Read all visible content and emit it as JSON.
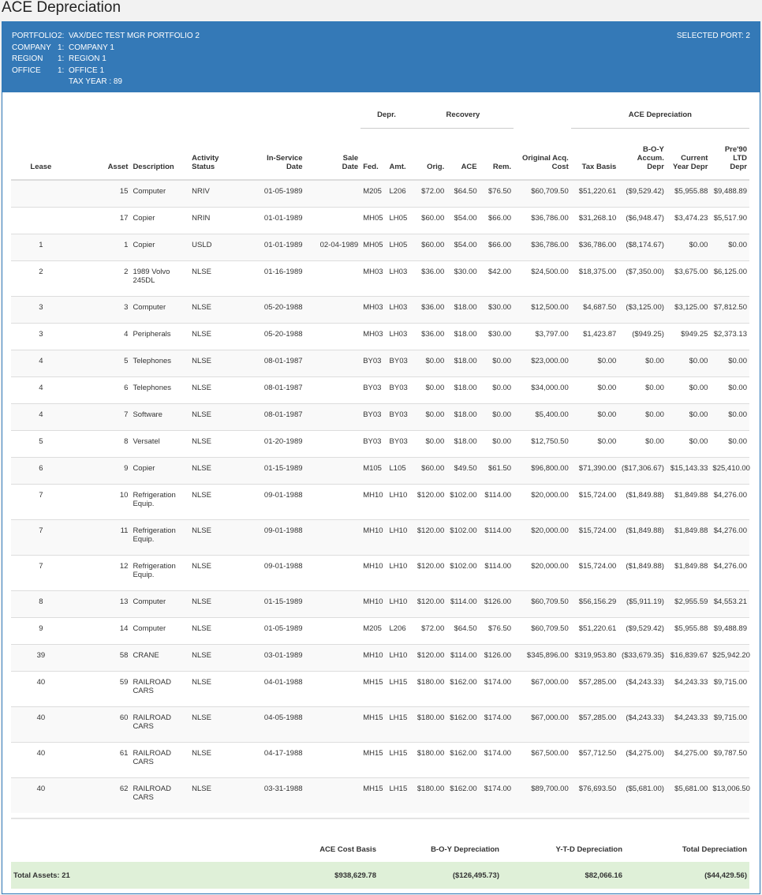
{
  "page": {
    "title": "ACE Depreciation"
  },
  "header": {
    "rows": [
      {
        "key": "PORTFOLIO",
        "num": "2:",
        "value": "VAX/DEC TEST MGR PORTFOLIO 2"
      },
      {
        "key": "COMPANY",
        "num": "1:",
        "value": "COMPANY 1"
      },
      {
        "key": "REGION",
        "num": "1:",
        "value": "REGION 1"
      },
      {
        "key": "OFFICE",
        "num": "1:",
        "value": "OFFICE 1"
      },
      {
        "key": "",
        "num": "",
        "value": "TAX YEAR : 89"
      }
    ],
    "selected_port": "SELECTED PORT: 2"
  },
  "groups": {
    "depr": "Depr.",
    "recovery": "Recovery",
    "ace_depr": "ACE Depreciation"
  },
  "columns": {
    "lease": "Lease",
    "asset": "Asset",
    "description": "Description",
    "activity_status_1": "Activity",
    "activity_status_2": "Status",
    "in_service_1": "In-Service",
    "in_service_2": "Date",
    "sale_1": "Sale",
    "sale_2": "Date",
    "fed": "Fed.",
    "amt": "Amt.",
    "orig": "Orig.",
    "ace": "ACE",
    "rem": "Rem.",
    "orig_cost_1": "Original Acq.",
    "orig_cost_2": "Cost",
    "tax_basis": "Tax Basis",
    "boy_1": "B-O-Y",
    "boy_2": "Accum.",
    "boy_3": "Depr",
    "cur_1": "Current",
    "cur_2": "Year Depr",
    "pre90_1": "Pre'90",
    "pre90_2": "LTD",
    "pre90_3": "Depr"
  },
  "rows": [
    {
      "lease": "",
      "asset": "15",
      "desc": "Computer",
      "status": "NRIV",
      "in_service": "01-05-1989",
      "sale": "",
      "fed": "M205",
      "amt": "L206",
      "orig": "$72.00",
      "ace": "$64.50",
      "rem": "$76.50",
      "cost": "$60,709.50",
      "tax_basis": "$51,220.61",
      "boy": "($9,529.42)",
      "cur": "$5,955.88",
      "pre90": "$9,488.89"
    },
    {
      "lease": "",
      "asset": "17",
      "desc": "Copier",
      "status": "NRIN",
      "in_service": "01-01-1989",
      "sale": "",
      "fed": "MH05",
      "amt": "LH05",
      "orig": "$60.00",
      "ace": "$54.00",
      "rem": "$66.00",
      "cost": "$36,786.00",
      "tax_basis": "$31,268.10",
      "boy": "($6,948.47)",
      "cur": "$3,474.23",
      "pre90": "$5,517.90"
    },
    {
      "lease": "1",
      "asset": "1",
      "desc": "Copier",
      "status": "USLD",
      "in_service": "01-01-1989",
      "sale": "02-04-1989",
      "fed": "MH05",
      "amt": "LH05",
      "orig": "$60.00",
      "ace": "$54.00",
      "rem": "$66.00",
      "cost": "$36,786.00",
      "tax_basis": "$36,786.00",
      "boy": "($8,174.67)",
      "cur": "$0.00",
      "pre90": "$0.00"
    },
    {
      "lease": "2",
      "asset": "2",
      "desc": "1989 Volvo 245DL",
      "status": "NLSE",
      "in_service": "01-16-1989",
      "sale": "",
      "fed": "MH03",
      "amt": "LH03",
      "orig": "$36.00",
      "ace": "$30.00",
      "rem": "$42.00",
      "cost": "$24,500.00",
      "tax_basis": "$18,375.00",
      "boy": "($7,350.00)",
      "cur": "$3,675.00",
      "pre90": "$6,125.00",
      "tall": true
    },
    {
      "lease": "3",
      "asset": "3",
      "desc": "Computer",
      "status": "NLSE",
      "in_service": "05-20-1988",
      "sale": "",
      "fed": "MH03",
      "amt": "LH03",
      "orig": "$36.00",
      "ace": "$18.00",
      "rem": "$30.00",
      "cost": "$12,500.00",
      "tax_basis": "$4,687.50",
      "boy": "($3,125.00)",
      "cur": "$3,125.00",
      "pre90": "$7,812.50"
    },
    {
      "lease": "3",
      "asset": "4",
      "desc": "Peripherals",
      "status": "NLSE",
      "in_service": "05-20-1988",
      "sale": "",
      "fed": "MH03",
      "amt": "LH03",
      "orig": "$36.00",
      "ace": "$18.00",
      "rem": "$30.00",
      "cost": "$3,797.00",
      "tax_basis": "$1,423.87",
      "boy": "($949.25)",
      "cur": "$949.25",
      "pre90": "$2,373.13"
    },
    {
      "lease": "4",
      "asset": "5",
      "desc": "Telephones",
      "status": "NLSE",
      "in_service": "08-01-1987",
      "sale": "",
      "fed": "BY03",
      "amt": "BY03",
      "orig": "$0.00",
      "ace": "$18.00",
      "rem": "$0.00",
      "cost": "$23,000.00",
      "tax_basis": "$0.00",
      "boy": "$0.00",
      "cur": "$0.00",
      "pre90": "$0.00"
    },
    {
      "lease": "4",
      "asset": "6",
      "desc": "Telephones",
      "status": "NLSE",
      "in_service": "08-01-1987",
      "sale": "",
      "fed": "BY03",
      "amt": "BY03",
      "orig": "$0.00",
      "ace": "$18.00",
      "rem": "$0.00",
      "cost": "$34,000.00",
      "tax_basis": "$0.00",
      "boy": "$0.00",
      "cur": "$0.00",
      "pre90": "$0.00"
    },
    {
      "lease": "4",
      "asset": "7",
      "desc": "Software",
      "status": "NLSE",
      "in_service": "08-01-1987",
      "sale": "",
      "fed": "BY03",
      "amt": "BY03",
      "orig": "$0.00",
      "ace": "$18.00",
      "rem": "$0.00",
      "cost": "$5,400.00",
      "tax_basis": "$0.00",
      "boy": "$0.00",
      "cur": "$0.00",
      "pre90": "$0.00"
    },
    {
      "lease": "5",
      "asset": "8",
      "desc": "Versatel",
      "status": "NLSE",
      "in_service": "01-20-1989",
      "sale": "",
      "fed": "BY03",
      "amt": "BY03",
      "orig": "$0.00",
      "ace": "$18.00",
      "rem": "$0.00",
      "cost": "$12,750.50",
      "tax_basis": "$0.00",
      "boy": "$0.00",
      "cur": "$0.00",
      "pre90": "$0.00"
    },
    {
      "lease": "6",
      "asset": "9",
      "desc": "Copier",
      "status": "NLSE",
      "in_service": "01-15-1989",
      "sale": "",
      "fed": "M105",
      "amt": "L105",
      "orig": "$60.00",
      "ace": "$49.50",
      "rem": "$61.50",
      "cost": "$96,800.00",
      "tax_basis": "$71,390.00",
      "boy": "($17,306.67)",
      "cur": "$15,143.33",
      "pre90": "$25,410.00"
    },
    {
      "lease": "7",
      "asset": "10",
      "desc": "Refrigeration Equip.",
      "status": "NLSE",
      "in_service": "09-01-1988",
      "sale": "",
      "fed": "MH10",
      "amt": "LH10",
      "orig": "$120.00",
      "ace": "$102.00",
      "rem": "$114.00",
      "cost": "$20,000.00",
      "tax_basis": "$15,724.00",
      "boy": "($1,849.88)",
      "cur": "$1,849.88",
      "pre90": "$4,276.00",
      "tall": true
    },
    {
      "lease": "7",
      "asset": "11",
      "desc": "Refrigeration Equip.",
      "status": "NLSE",
      "in_service": "09-01-1988",
      "sale": "",
      "fed": "MH10",
      "amt": "LH10",
      "orig": "$120.00",
      "ace": "$102.00",
      "rem": "$114.00",
      "cost": "$20,000.00",
      "tax_basis": "$15,724.00",
      "boy": "($1,849.88)",
      "cur": "$1,849.88",
      "pre90": "$4,276.00",
      "tall": true
    },
    {
      "lease": "7",
      "asset": "12",
      "desc": "Refrigeration Equip.",
      "status": "NLSE",
      "in_service": "09-01-1988",
      "sale": "",
      "fed": "MH10",
      "amt": "LH10",
      "orig": "$120.00",
      "ace": "$102.00",
      "rem": "$114.00",
      "cost": "$20,000.00",
      "tax_basis": "$15,724.00",
      "boy": "($1,849.88)",
      "cur": "$1,849.88",
      "pre90": "$4,276.00",
      "tall": true
    },
    {
      "lease": "8",
      "asset": "13",
      "desc": "Computer",
      "status": "NLSE",
      "in_service": "01-15-1989",
      "sale": "",
      "fed": "MH10",
      "amt": "LH10",
      "orig": "$120.00",
      "ace": "$114.00",
      "rem": "$126.00",
      "cost": "$60,709.50",
      "tax_basis": "$56,156.29",
      "boy": "($5,911.19)",
      "cur": "$2,955.59",
      "pre90": "$4,553.21"
    },
    {
      "lease": "9",
      "asset": "14",
      "desc": "Computer",
      "status": "NLSE",
      "in_service": "01-05-1989",
      "sale": "",
      "fed": "M205",
      "amt": "L206",
      "orig": "$72.00",
      "ace": "$64.50",
      "rem": "$76.50",
      "cost": "$60,709.50",
      "tax_basis": "$51,220.61",
      "boy": "($9,529.42)",
      "cur": "$5,955.88",
      "pre90": "$9,488.89"
    },
    {
      "lease": "39",
      "asset": "58",
      "desc": "CRANE",
      "status": "NLSE",
      "in_service": "03-01-1989",
      "sale": "",
      "fed": "MH10",
      "amt": "LH10",
      "orig": "$120.00",
      "ace": "$114.00",
      "rem": "$126.00",
      "cost": "$345,896.00",
      "tax_basis": "$319,953.80",
      "boy": "($33,679.35)",
      "cur": "$16,839.67",
      "pre90": "$25,942.20"
    },
    {
      "lease": "40",
      "asset": "59",
      "desc": "RAILROAD CARS",
      "status": "NLSE",
      "in_service": "04-01-1988",
      "sale": "",
      "fed": "MH15",
      "amt": "LH15",
      "orig": "$180.00",
      "ace": "$162.00",
      "rem": "$174.00",
      "cost": "$67,000.00",
      "tax_basis": "$57,285.00",
      "boy": "($4,243.33)",
      "cur": "$4,243.33",
      "pre90": "$9,715.00",
      "tall": true
    },
    {
      "lease": "40",
      "asset": "60",
      "desc": "RAILROAD CARS",
      "status": "NLSE",
      "in_service": "04-05-1988",
      "sale": "",
      "fed": "MH15",
      "amt": "LH15",
      "orig": "$180.00",
      "ace": "$162.00",
      "rem": "$174.00",
      "cost": "$67,000.00",
      "tax_basis": "$57,285.00",
      "boy": "($4,243.33)",
      "cur": "$4,243.33",
      "pre90": "$9,715.00",
      "tall": true
    },
    {
      "lease": "40",
      "asset": "61",
      "desc": "RAILROAD CARS",
      "status": "NLSE",
      "in_service": "04-17-1988",
      "sale": "",
      "fed": "MH15",
      "amt": "LH15",
      "orig": "$180.00",
      "ace": "$162.00",
      "rem": "$174.00",
      "cost": "$67,500.00",
      "tax_basis": "$57,712.50",
      "boy": "($4,275.00)",
      "cur": "$4,275.00",
      "pre90": "$9,787.50",
      "tall": true
    },
    {
      "lease": "40",
      "asset": "62",
      "desc": "RAILROAD CARS",
      "status": "NLSE",
      "in_service": "03-31-1988",
      "sale": "",
      "fed": "MH15",
      "amt": "LH15",
      "orig": "$180.00",
      "ace": "$162.00",
      "rem": "$174.00",
      "cost": "$89,700.00",
      "tax_basis": "$76,693.50",
      "boy": "($5,681.00)",
      "cur": "$5,681.00",
      "pre90": "$13,006.50",
      "tall": true
    }
  ],
  "summary": {
    "headers": {
      "ace_cost_basis": "ACE Cost Basis",
      "boy_depr": "B-O-Y Depreciation",
      "ytd_depr": "Y-T-D Depreciation",
      "total_depr": "Total Depreciation"
    },
    "total_label": "Total Assets: 21",
    "ace_cost_basis": "$938,629.78",
    "boy_depr": "($126,495.73)",
    "ytd_depr": "$82,066.16",
    "total_depr": "($44,429.56)"
  }
}
